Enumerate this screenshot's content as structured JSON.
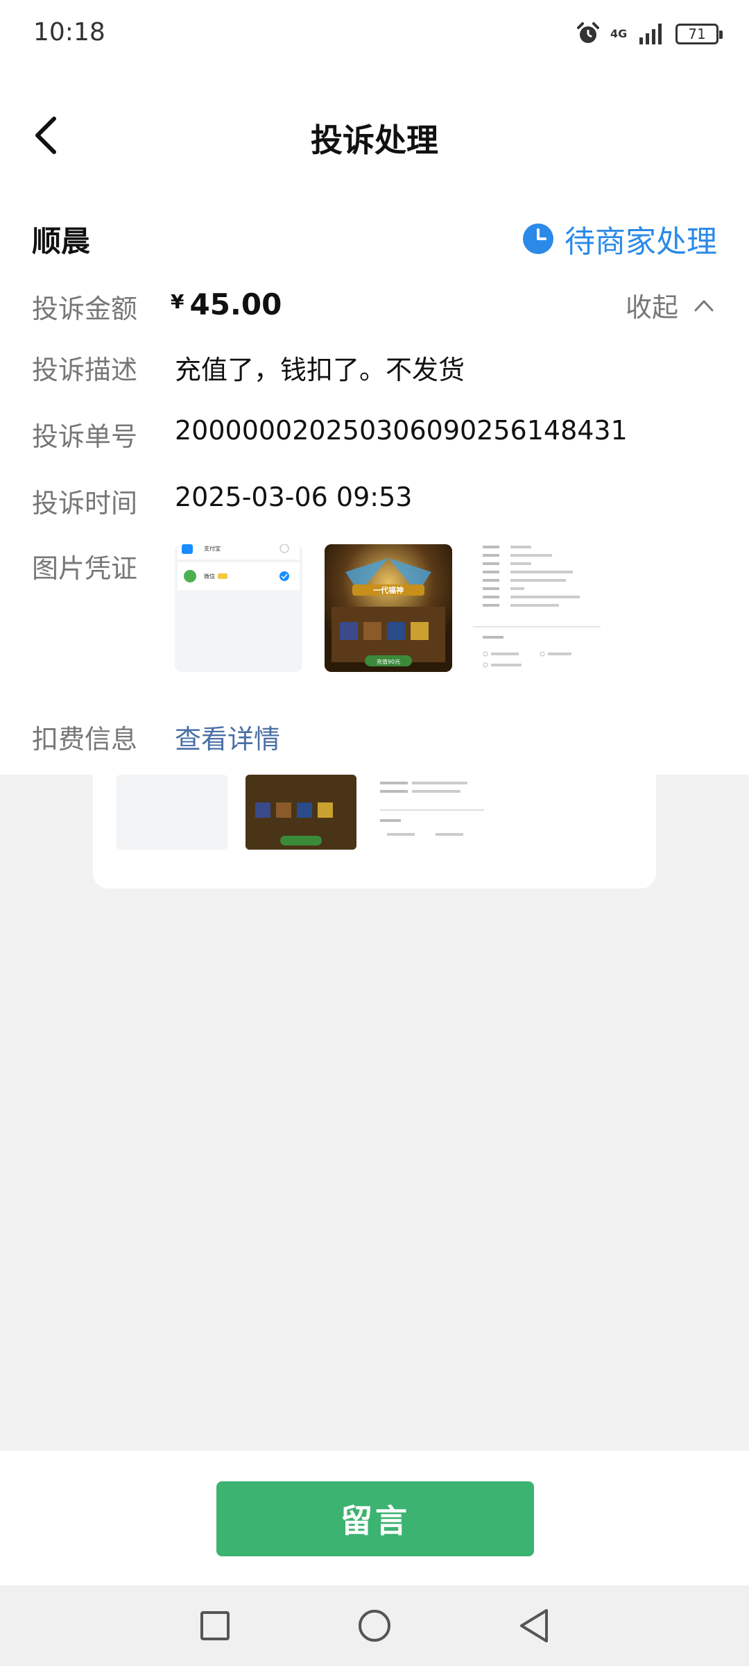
{
  "status_bar": {
    "time": "10:18",
    "network": "4G",
    "battery": "71"
  },
  "header": {
    "title": "投诉处理",
    "back_icon": "chevron-left-icon"
  },
  "complaint": {
    "merchant": "顺晨",
    "status": "待商家处理",
    "status_icon": "clock-icon",
    "status_color": "#2b8ae8",
    "collapse_label": "收起",
    "rows": {
      "amount": {
        "label": "投诉金额",
        "currency": "¥",
        "value": "45.00"
      },
      "description": {
        "label": "投诉描述",
        "value": "充值了，钱扣了。不发货"
      },
      "order_no": {
        "label": "投诉单号",
        "value": "200000020250306090256148431"
      },
      "time": {
        "label": "投诉时间",
        "value": "2025-03-06 09:53"
      },
      "images": {
        "label": "图片凭证"
      },
      "fee": {
        "label": "扣费信息",
        "link": "查看详情"
      }
    },
    "thumb_texts": {
      "pay_option_1": "支付宝",
      "pay_option_2": "微信",
      "game_banner": "一代福神",
      "game_button": "充值90元"
    }
  },
  "actions": {
    "message_button": "留言",
    "accent": "#3cb371"
  }
}
